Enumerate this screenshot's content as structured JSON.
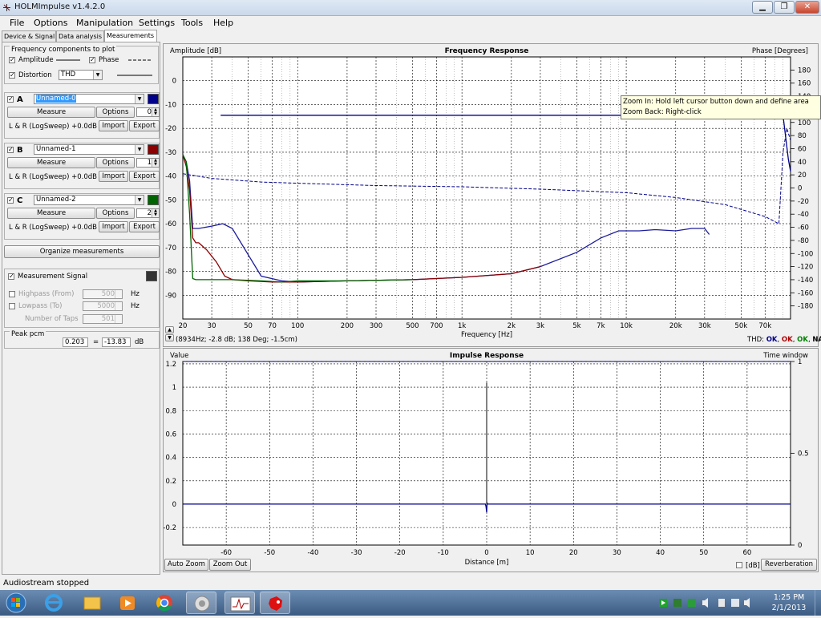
{
  "window": {
    "title": "HOLMImpulse  v1.4.2.0"
  },
  "menu": [
    "File",
    "Options",
    "Manipulation",
    "Settings",
    "Tools",
    "Help"
  ],
  "tabs": [
    "Device & Signal",
    "Data analysis",
    "Measurements"
  ],
  "freq_components": {
    "title": "Frequency components to plot",
    "amplitude_label": "Amplitude",
    "phase_label": "Phase",
    "distortion_label": "Distortion",
    "distortion_value": "THD"
  },
  "measurements": [
    {
      "letter": "A",
      "name": "Unnamed-0",
      "color": "#00008b",
      "measure": "Measure",
      "options": "Options",
      "spin": "0",
      "info": "L & R (LogSweep) +0.0dB",
      "import": "Import",
      "export": "Export",
      "checked": "✓"
    },
    {
      "letter": "B",
      "name": "Unnamed-1",
      "color": "#8b0000",
      "measure": "Measure",
      "options": "Options",
      "spin": "1",
      "info": "L & R (LogSweep) +0.0dB",
      "import": "Import",
      "export": "Export",
      "checked": "✓"
    },
    {
      "letter": "C",
      "name": "Unnamed-2",
      "color": "#006400",
      "measure": "Measure",
      "options": "Options",
      "spin": "2",
      "info": "L & R (LogSweep) +0.0dB",
      "import": "Import",
      "export": "Export",
      "checked": "✓"
    }
  ],
  "organize_label": "Organize measurements",
  "signal": {
    "label": "Measurement Signal",
    "color": "#333333",
    "highpass_label": "Highpass (From)",
    "highpass_value": "500",
    "lowpass_label": "Lowpass (To)",
    "lowpass_value": "5000",
    "taps_label": "Number of Taps",
    "taps_value": "501",
    "hz": "Hz"
  },
  "peak": {
    "label": "Peak pcm",
    "value": "0.203",
    "eq": "=",
    "db_value": "-13.83",
    "unit": "dB"
  },
  "tooltip": {
    "line1": "Zoom In:  Hold left cursor button down and define area",
    "line2": "Zoom Back: Right-click"
  },
  "freq_extra": {
    "cursor": "(8934Hz; -2.8 dB; 138 Deg; -1.5cm)",
    "thd_label": "THD:",
    "thd_items": [
      {
        "text": "OK",
        "color": "#00008b"
      },
      {
        "text": "OK",
        "color": "#b00000"
      },
      {
        "text": "OK",
        "color": "#008000"
      },
      {
        "text": "NA",
        "color": "#000000"
      }
    ]
  },
  "impulse_buttons": {
    "auto_zoom": "Auto Zoom",
    "zoom_out": "Zoom Out",
    "db": "[dB]",
    "reverb": "Reverberation"
  },
  "status": "Audiostream stopped",
  "clock": {
    "time": "1:25 PM",
    "date": "2/1/2013"
  },
  "chart_data": [
    {
      "type": "line",
      "title": "Frequency Response",
      "ylabel": "Amplitude [dB]",
      "y2label": "Phase [Degrees]",
      "xlabel": "Frequency [Hz]",
      "xscale": "log",
      "xlim": [
        20,
        100000
      ],
      "ylim": [
        -100,
        10
      ],
      "y2lim": [
        -200,
        200
      ],
      "xticks": [
        20,
        30,
        50,
        70,
        100,
        200,
        300,
        500,
        700,
        1000,
        2000,
        3000,
        5000,
        7000,
        10000,
        20000,
        30000,
        50000,
        70000
      ],
      "xtick_labels": [
        "20",
        "30",
        "50",
        "70",
        "100",
        "200",
        "300",
        "500",
        "700",
        "1k",
        "2k",
        "3k",
        "5k",
        "7k",
        "10k",
        "20k",
        "30k",
        "50k",
        "70k"
      ],
      "yticks": [
        0,
        -10,
        -20,
        -30,
        -40,
        -50,
        -60,
        -70,
        -80,
        -90
      ],
      "y2ticks": [
        180,
        160,
        140,
        120,
        100,
        80,
        60,
        40,
        20,
        0,
        -20,
        -40,
        -60,
        -80,
        -100,
        -120,
        -140,
        -160,
        -180
      ],
      "grid": true,
      "series": [
        {
          "color": "#00008b",
          "style": "solid",
          "x": [
            34,
            90000,
            92000,
            97000,
            100000
          ],
          "y": [
            -14.5,
            -14.5,
            -20,
            -33,
            -38
          ]
        },
        {
          "color": "#00008b",
          "style": "dashed",
          "x": [
            20,
            30,
            60,
            100,
            300,
            1000,
            3000,
            10000,
            20000,
            40000,
            70000,
            85000,
            90000,
            95000,
            100000
          ],
          "y": [
            -39,
            -41,
            -42.5,
            -43,
            -44,
            -44.5,
            -45.5,
            -47,
            -49,
            -52,
            -57,
            -60,
            -30,
            -20,
            -25
          ]
        },
        {
          "color": "#1c1c9c",
          "style": "solid",
          "x": [
            20,
            21,
            22,
            23,
            24,
            25,
            30,
            35,
            40,
            50,
            60,
            80,
            100,
            200,
            500,
            1000,
            2000,
            3000,
            5000,
            7000,
            9000,
            12000,
            15000,
            20000,
            25000,
            30000,
            32000
          ],
          "y": [
            -31,
            -34,
            -42,
            -62,
            -62,
            -62,
            -61,
            -60,
            -62,
            -73,
            -82,
            -84,
            -84.5,
            -84,
            -83.5,
            -82.5,
            -81,
            -78,
            -72,
            -66,
            -63,
            -63,
            -62.5,
            -63,
            -62,
            -62,
            -64.5
          ]
        },
        {
          "color": "#8b0000",
          "style": "solid",
          "x": [
            20,
            21,
            22,
            23,
            24,
            25,
            28,
            32,
            36,
            40,
            50,
            70,
            100,
            200,
            500,
            1000,
            2000,
            3000
          ],
          "y": [
            -31,
            -36,
            -46,
            -66,
            -68,
            -68,
            -71,
            -76,
            -82,
            -83.5,
            -84,
            -84.5,
            -84.5,
            -84,
            -83.5,
            -82.5,
            -81,
            -78
          ]
        },
        {
          "color": "#006400",
          "style": "solid",
          "x": [
            20,
            21,
            22,
            23,
            24,
            25,
            30,
            40,
            60,
            80,
            100,
            200,
            500
          ],
          "y": [
            -31,
            -34,
            -56,
            -83,
            -83.5,
            -83.5,
            -83.5,
            -83.5,
            -84,
            -84.5,
            -84,
            -84,
            -83.5
          ]
        }
      ]
    },
    {
      "type": "line",
      "title": "Impulse Response",
      "ylabel": "Value",
      "y2label": "Time window",
      "xlabel": "Distance [m]",
      "xlim": [
        -70,
        70
      ],
      "ylim": [
        -0.35,
        1.22
      ],
      "y2lim": [
        0,
        1
      ],
      "xticks": [
        -60,
        -50,
        -40,
        -30,
        -20,
        -10,
        0,
        10,
        20,
        30,
        40,
        50,
        60
      ],
      "yticks": [
        1.2,
        1,
        0.8,
        0.6,
        0.4,
        0.2,
        0,
        -0.2
      ],
      "y2ticks": [
        1,
        0.5,
        0
      ],
      "grid": true,
      "series": [
        {
          "color": "#00008b",
          "style": "solid",
          "x": [
            -70,
            -0.3,
            -0.15,
            0,
            0.1,
            0.25,
            70
          ],
          "y": [
            0,
            0,
            -0.02,
            -0.07,
            0.01,
            0,
            0
          ]
        },
        {
          "color": "#404040",
          "style": "solid",
          "x": [
            0,
            0
          ],
          "y": [
            0,
            1.04
          ]
        },
        {
          "color": "#00008b",
          "style": "dashed",
          "axis": "y2",
          "x": [
            -70,
            70
          ],
          "y": [
            1,
            1
          ]
        }
      ]
    }
  ]
}
